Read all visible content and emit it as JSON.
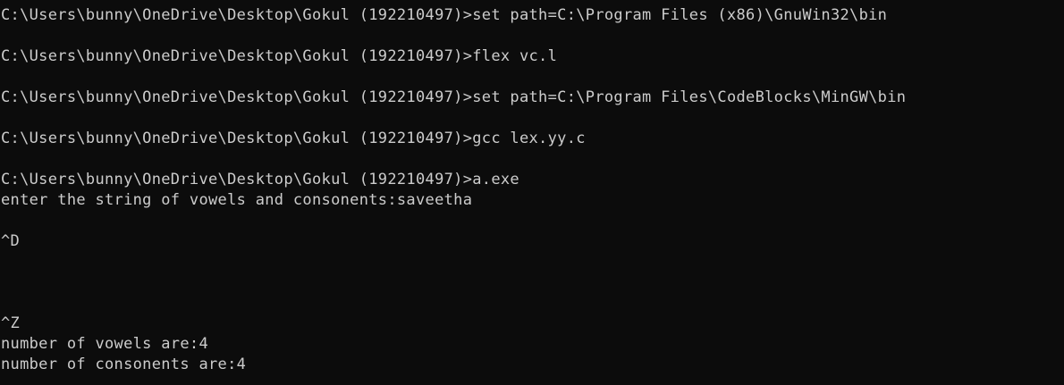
{
  "terminal": {
    "lines": [
      "C:\\Users\\bunny\\OneDrive\\Desktop\\Gokul (192210497)>set path=C:\\Program Files (x86)\\GnuWin32\\bin",
      "C:\\Users\\bunny\\OneDrive\\Desktop\\Gokul (192210497)>flex vc.l",
      "C:\\Users\\bunny\\OneDrive\\Desktop\\Gokul (192210497)>set path=C:\\Program Files\\CodeBlocks\\MinGW\\bin",
      "C:\\Users\\bunny\\OneDrive\\Desktop\\Gokul (192210497)>gcc lex.yy.c",
      "C:\\Users\\bunny\\OneDrive\\Desktop\\Gokul (192210497)>a.exe",
      "enter the string of vowels and consonents:saveetha",
      "^D",
      "^Z",
      "number of vowels are:4",
      "number of consonents are:4"
    ]
  }
}
